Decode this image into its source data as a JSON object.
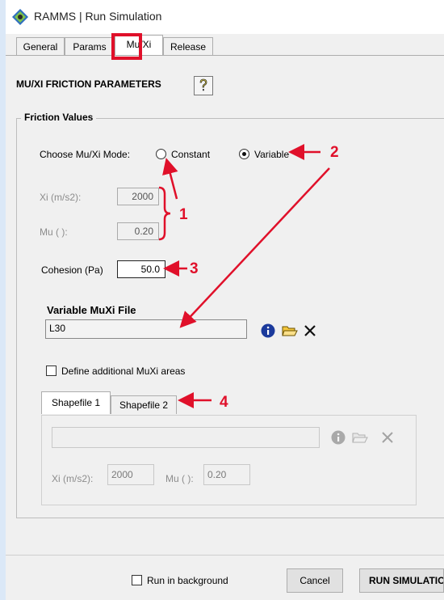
{
  "window": {
    "title": "RAMMS | Run Simulation"
  },
  "tabs": [
    {
      "label": "General"
    },
    {
      "label": "Params"
    },
    {
      "label": "Mu/Xi"
    },
    {
      "label": "Release"
    }
  ],
  "section": {
    "title": "MU/XI FRICTION PARAMETERS",
    "help_icon": "question-icon"
  },
  "friction": {
    "group_label": "Friction Values",
    "mode_label": "Choose Mu/Xi Mode:",
    "mode_options": [
      {
        "label": "Constant",
        "selected": false
      },
      {
        "label": "Variable",
        "selected": true
      }
    ],
    "xi_label": "Xi (m/s2):",
    "xi_value": "2000",
    "mu_label": "Mu ( ):",
    "mu_value": "0.20",
    "cohesion_label": "Cohesion (Pa)",
    "cohesion_value": "50.0",
    "variable_file_label": "Variable MuXi File",
    "variable_file_value": "L30",
    "additional_areas_label": "Define additional MuXi areas",
    "additional_areas_checked": false
  },
  "shapefiles": {
    "tabs": [
      {
        "label": "Shapefile 1"
      },
      {
        "label": "Shapefile 2"
      }
    ],
    "file_value": "",
    "xi_label": "Xi (m/s2):",
    "xi_value": "2000",
    "mu_label": "Mu ( ):",
    "mu_value": "0.20"
  },
  "footer": {
    "background_label": "Run in background",
    "background_checked": false,
    "cancel_label": "Cancel",
    "run_label": "RUN SIMULATION"
  },
  "annotations": {
    "a1": "1",
    "a2": "2",
    "a3": "3",
    "a4": "4"
  },
  "colors": {
    "annotation": "#e0102a",
    "info_icon": "#1b3a9c",
    "folder_icon": "#f3c63c"
  }
}
